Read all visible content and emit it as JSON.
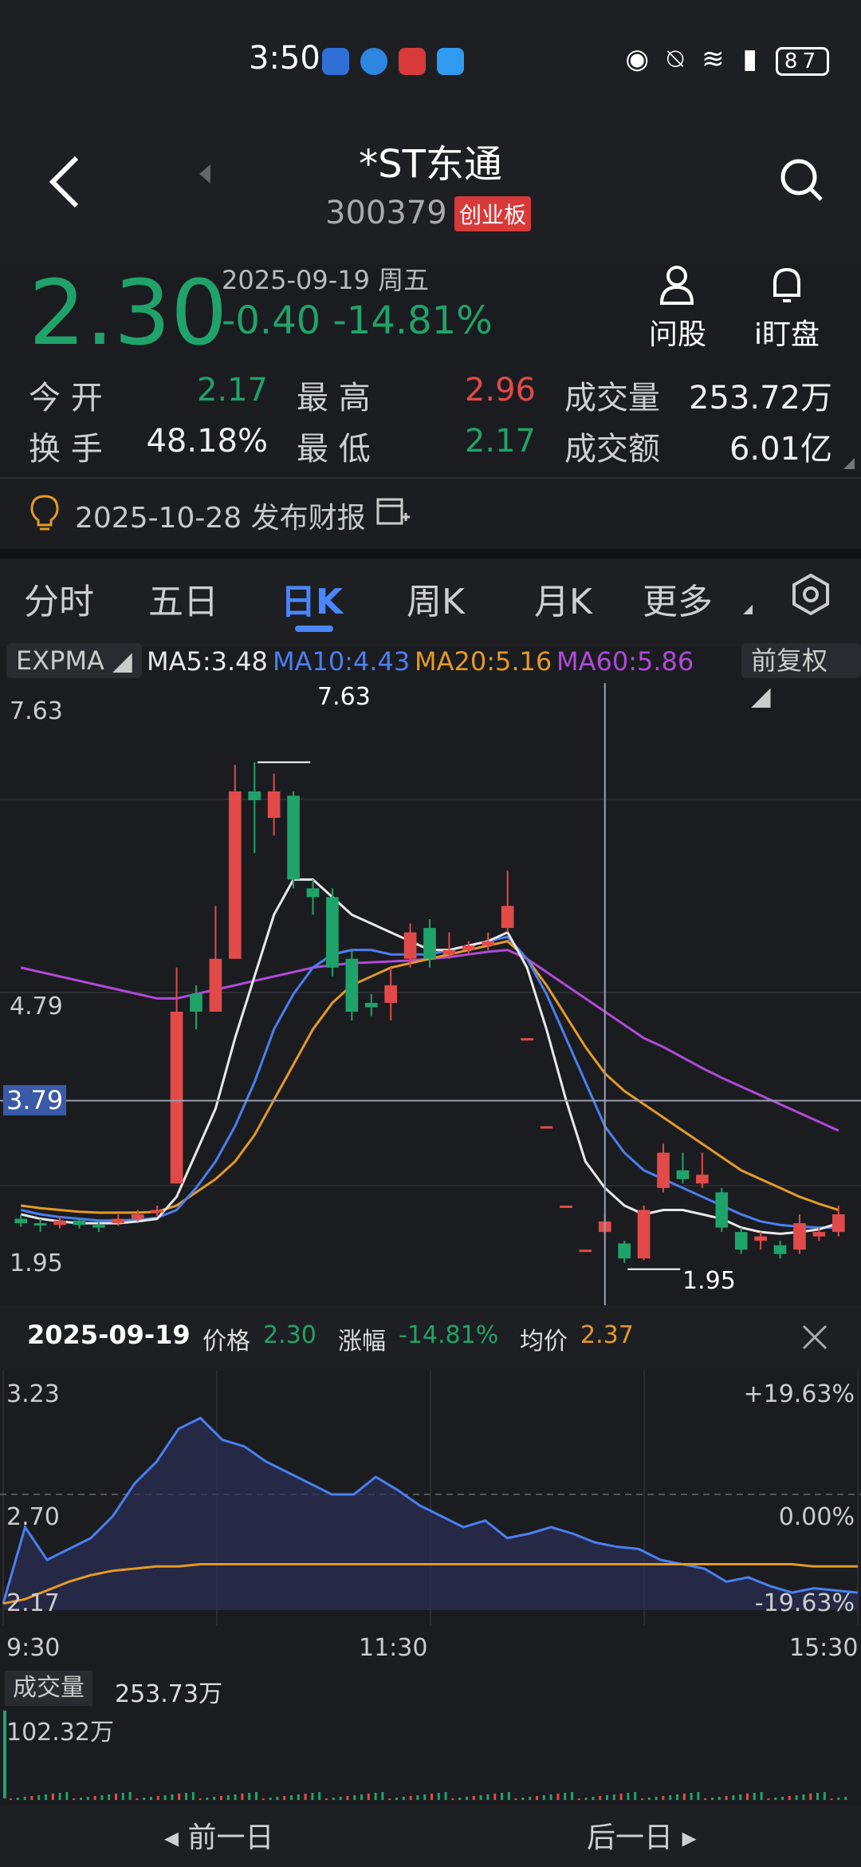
{
  "status_bar": {
    "time": "3:50",
    "battery": "87"
  },
  "header": {
    "title": "*ST东通",
    "code": "300379",
    "board": "创业板"
  },
  "quote": {
    "price": "2.30",
    "date": "2025-09-19 周五",
    "change": "-0.40 -14.81%",
    "actions": [
      "问股",
      "i盯盘"
    ]
  },
  "stats": {
    "row1": [
      {
        "label": "今 开",
        "value": "2.17",
        "color": "green"
      },
      {
        "label": "最 高",
        "value": "2.96",
        "color": "red"
      },
      {
        "label": "成交量",
        "value": "253.72万",
        "color": "white"
      }
    ],
    "row2": [
      {
        "label": "换 手",
        "value": "48.18%",
        "color": "white"
      },
      {
        "label": "最 低",
        "value": "2.17",
        "color": "green"
      },
      {
        "label": "成交额",
        "value": "6.01亿",
        "color": "white"
      }
    ]
  },
  "notice": {
    "text": "2025-10-28 发布财报"
  },
  "tabs": [
    "分时",
    "五日",
    "日K",
    "周K",
    "月K",
    "更多"
  ],
  "active_tab": "日K",
  "indicators": {
    "type": "EXPMA",
    "ma5": "MA5:3.48",
    "ma10": "MA10:4.43",
    "ma20": "MA20:5.16",
    "ma60": "MA60:5.86",
    "adjust": "前复权",
    "colors": {
      "ma5": "#e8e8e8",
      "ma10": "#4a7ff0",
      "ma20": "#e39a26",
      "ma60": "#b04ad8"
    }
  },
  "chart_data": [
    {
      "type": "candlestick",
      "y_ticks": [
        "7.63",
        "4.79",
        "1.95"
      ],
      "crosshair_value": "3.79",
      "high_label": "7.63",
      "low_label": "1.95",
      "colors": {
        "up": "#e24a4a",
        "down": "#1fa36a"
      },
      "candles": [
        [
          2.45,
          2.4,
          2.5,
          2.36
        ],
        [
          2.4,
          2.38,
          2.45,
          2.3
        ],
        [
          2.38,
          2.43,
          2.48,
          2.34
        ],
        [
          2.43,
          2.38,
          2.46,
          2.34
        ],
        [
          2.38,
          2.35,
          2.42,
          2.3
        ],
        [
          2.4,
          2.45,
          2.5,
          2.37
        ],
        [
          2.45,
          2.5,
          2.55,
          2.42
        ],
        [
          2.52,
          2.55,
          2.6,
          2.48
        ],
        [
          2.85,
          4.8,
          5.3,
          2.85
        ],
        [
          5.0,
          4.8,
          5.1,
          4.6
        ],
        [
          4.8,
          5.4,
          6.0,
          4.8
        ],
        [
          5.4,
          7.3,
          7.6,
          5.4
        ],
        [
          7.3,
          7.2,
          7.63,
          6.6
        ],
        [
          7.0,
          7.3,
          7.5,
          6.8
        ],
        [
          7.25,
          6.3,
          7.3,
          6.2
        ],
        [
          6.2,
          6.1,
          6.3,
          5.9
        ],
        [
          6.1,
          5.3,
          6.2,
          5.2
        ],
        [
          5.4,
          4.8,
          5.5,
          4.7
        ],
        [
          4.9,
          4.85,
          5.0,
          4.75
        ],
        [
          4.9,
          5.1,
          5.3,
          4.7
        ],
        [
          5.4,
          5.7,
          5.8,
          5.3
        ],
        [
          5.75,
          5.4,
          5.85,
          5.3
        ],
        [
          5.45,
          5.5,
          5.7,
          5.4
        ],
        [
          5.5,
          5.55,
          5.6,
          5.45
        ],
        [
          5.55,
          5.6,
          5.7,
          5.5
        ],
        [
          5.75,
          6.0,
          6.4,
          5.7
        ],
        [
          4.5,
          4.5,
          4.5,
          4.5
        ],
        [
          3.5,
          3.5,
          3.5,
          3.5
        ],
        [
          2.6,
          2.6,
          2.6,
          2.6
        ],
        [
          2.1,
          2.1,
          2.1,
          2.1
        ],
        [
          2.3,
          2.42,
          2.5,
          2.28
        ],
        [
          2.17,
          2.0,
          2.2,
          1.95
        ],
        [
          2.0,
          2.55,
          2.6,
          1.98
        ],
        [
          2.8,
          3.2,
          3.3,
          2.75
        ],
        [
          3.0,
          2.9,
          3.2,
          2.85
        ],
        [
          2.85,
          2.95,
          3.2,
          2.8
        ],
        [
          2.75,
          2.35,
          2.8,
          2.3
        ],
        [
          2.3,
          2.1,
          2.35,
          2.05
        ],
        [
          2.2,
          2.25,
          2.3,
          2.1
        ],
        [
          2.15,
          2.05,
          2.2,
          2.0
        ],
        [
          2.1,
          2.4,
          2.5,
          2.05
        ],
        [
          2.25,
          2.3,
          2.35,
          2.2
        ],
        [
          2.3,
          2.5,
          2.6,
          2.25
        ]
      ],
      "ma5": [
        2.5,
        2.45,
        2.42,
        2.4,
        2.4,
        2.4,
        2.42,
        2.45,
        2.7,
        3.2,
        3.7,
        4.5,
        5.2,
        5.9,
        6.3,
        6.3,
        6.1,
        5.9,
        5.8,
        5.7,
        5.6,
        5.5,
        5.5,
        5.55,
        5.6,
        5.7,
        5.3,
        4.6,
        3.8,
        3.1,
        2.8,
        2.6,
        2.5,
        2.55,
        2.55,
        2.5,
        2.45,
        2.35,
        2.3,
        2.28,
        2.3,
        2.33,
        2.4
      ],
      "ma10": [
        2.55,
        2.5,
        2.47,
        2.45,
        2.43,
        2.43,
        2.44,
        2.46,
        2.55,
        2.8,
        3.1,
        3.5,
        4.0,
        4.6,
        5.0,
        5.3,
        5.45,
        5.5,
        5.5,
        5.45,
        5.45,
        5.45,
        5.5,
        5.55,
        5.6,
        5.65,
        5.4,
        5.0,
        4.5,
        4.0,
        3.5,
        3.2,
        3.0,
        2.9,
        2.8,
        2.7,
        2.6,
        2.5,
        2.42,
        2.38,
        2.36,
        2.35,
        2.35
      ],
      "ma20": [
        2.6,
        2.57,
        2.55,
        2.53,
        2.52,
        2.52,
        2.52,
        2.53,
        2.6,
        2.75,
        2.9,
        3.1,
        3.4,
        3.8,
        4.2,
        4.6,
        4.9,
        5.1,
        5.2,
        5.3,
        5.35,
        5.4,
        5.45,
        5.5,
        5.55,
        5.6,
        5.4,
        5.1,
        4.75,
        4.4,
        4.1,
        3.9,
        3.75,
        3.6,
        3.45,
        3.3,
        3.15,
        3.0,
        2.9,
        2.8,
        2.7,
        2.62,
        2.55
      ],
      "ma60": [
        5.3,
        5.25,
        5.2,
        5.15,
        5.1,
        5.05,
        5.0,
        4.95,
        4.95,
        5.0,
        5.05,
        5.1,
        5.15,
        5.2,
        5.25,
        5.3,
        5.33,
        5.35,
        5.36,
        5.37,
        5.38,
        5.4,
        5.42,
        5.45,
        5.48,
        5.5,
        5.4,
        5.25,
        5.1,
        4.95,
        4.8,
        4.65,
        4.5,
        4.4,
        4.28,
        4.16,
        4.05,
        3.95,
        3.85,
        3.75,
        3.65,
        3.55,
        3.45
      ]
    },
    {
      "type": "line",
      "price_ticks_left": [
        "3.23",
        "2.70",
        "2.17"
      ],
      "pct_ticks_right": [
        "+19.63%",
        "0.00%",
        "-19.63%"
      ],
      "x_ticks": [
        "9:30",
        "11:30",
        "15:30"
      ],
      "price": [
        2.2,
        2.55,
        2.4,
        2.45,
        2.5,
        2.6,
        2.75,
        2.85,
        3.0,
        3.05,
        2.95,
        2.92,
        2.85,
        2.8,
        2.75,
        2.7,
        2.7,
        2.78,
        2.72,
        2.65,
        2.6,
        2.55,
        2.58,
        2.5,
        2.52,
        2.55,
        2.52,
        2.48,
        2.46,
        2.45,
        2.4,
        2.38,
        2.36,
        2.3,
        2.32,
        2.28,
        2.25,
        2.27,
        2.26,
        2.25
      ],
      "avg": [
        2.2,
        2.22,
        2.26,
        2.3,
        2.33,
        2.35,
        2.36,
        2.37,
        2.37,
        2.38,
        2.38,
        2.38,
        2.38,
        2.38,
        2.38,
        2.38,
        2.38,
        2.38,
        2.38,
        2.38,
        2.38,
        2.38,
        2.38,
        2.38,
        2.38,
        2.38,
        2.38,
        2.38,
        2.38,
        2.38,
        2.38,
        2.38,
        2.38,
        2.38,
        2.38,
        2.38,
        2.38,
        2.37,
        2.37,
        2.37
      ]
    }
  ],
  "intraday_info": {
    "date": "2025-09-19",
    "price_label": "价格",
    "price": "2.30",
    "chg_label": "涨幅",
    "chg": "-14.81%",
    "avg_label": "均价",
    "avg": "2.37"
  },
  "volume": {
    "label": "成交量",
    "value": "253.73万",
    "max": "102.32万"
  },
  "nav": {
    "prev": "前一日",
    "next": "后一日"
  }
}
